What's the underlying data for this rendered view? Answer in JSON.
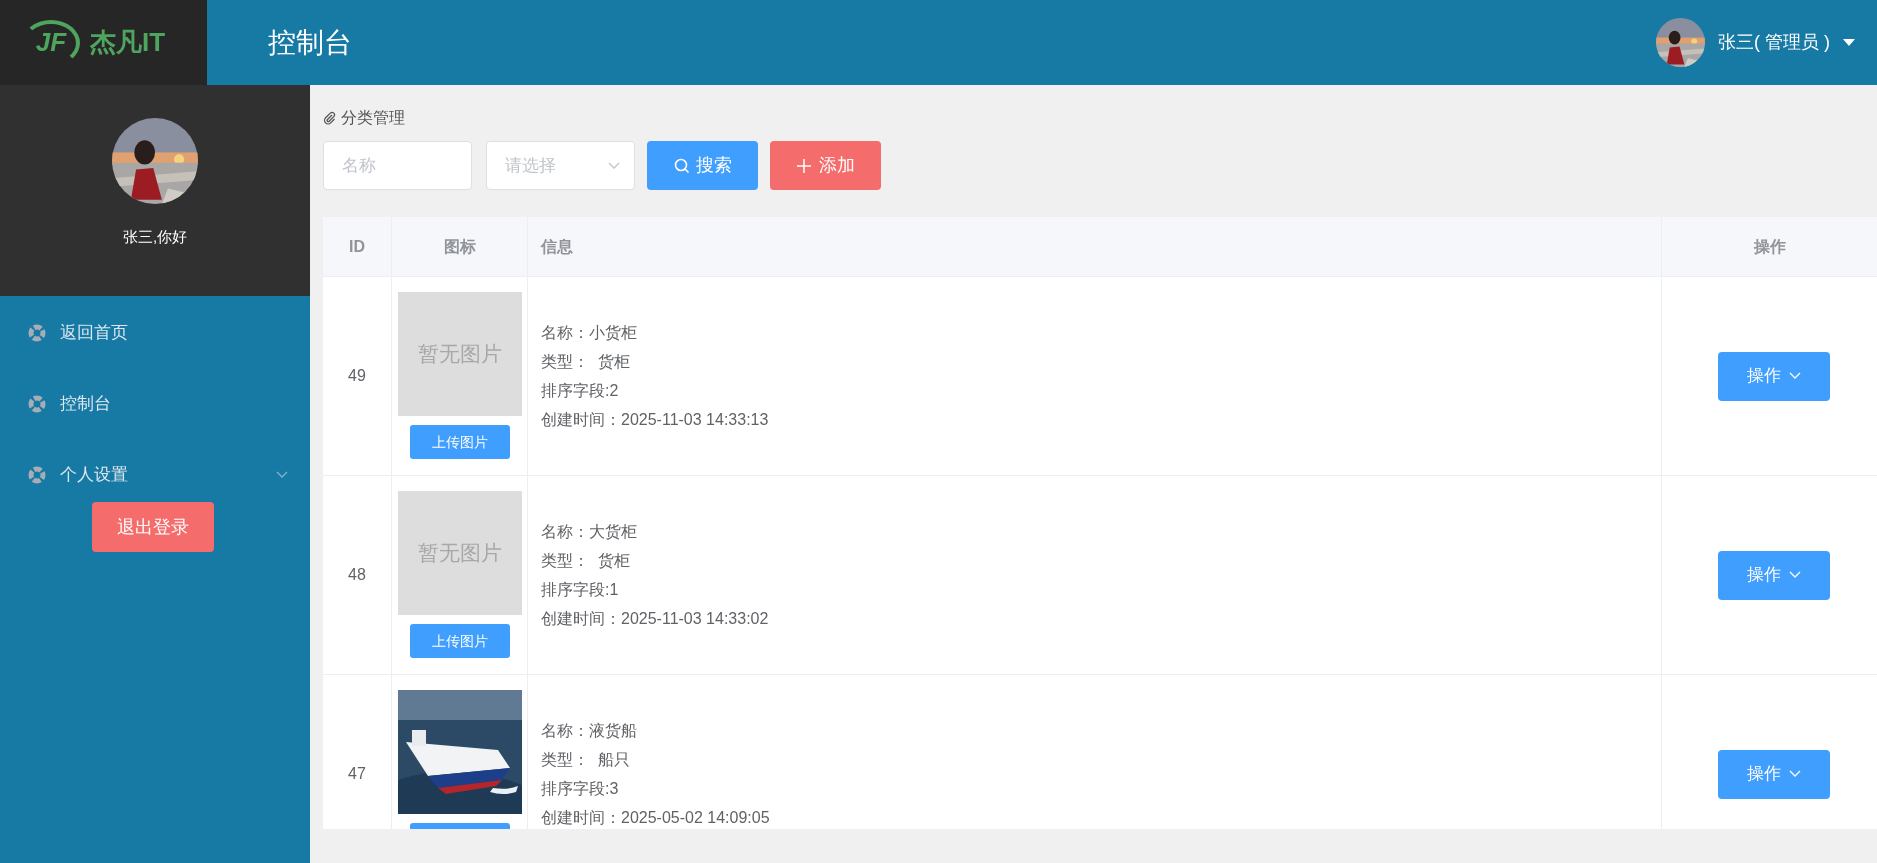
{
  "header": {
    "logo": {
      "mark": "JF",
      "name": "杰凡IT"
    },
    "title": "控制台",
    "user": {
      "name": "张三( 管理员 )"
    }
  },
  "sidebar": {
    "greeting": "张三,你好",
    "items": [
      {
        "label": "返回首页",
        "kind": "link"
      },
      {
        "label": "控制台",
        "kind": "link"
      },
      {
        "label": "个人设置",
        "kind": "submenu",
        "expanded": false
      }
    ],
    "logout": "退出登录"
  },
  "breadcrumb": "分类管理",
  "filters": {
    "name": {
      "placeholder": "名称"
    },
    "type": {
      "placeholder": "请选择"
    },
    "search": "搜索",
    "add": "添加"
  },
  "table": {
    "columns": [
      "ID",
      "图标",
      "信息",
      "操作"
    ],
    "rows": [
      {
        "id": "49",
        "image": {
          "kind": "placeholder",
          "text": "暂无图片"
        },
        "upload": "上传图片",
        "info": [
          "名称：小货柜",
          "类型：  货柜",
          "排序字段:2",
          "创建时间：2025-11-03 14:33:13"
        ],
        "action": "操作"
      },
      {
        "id": "48",
        "image": {
          "kind": "placeholder",
          "text": "暂无图片"
        },
        "upload": "上传图片",
        "info": [
          "名称：大货柜",
          "类型：  货柜",
          "排序字段:1",
          "创建时间：2025-11-03 14:33:02"
        ],
        "action": "操作"
      },
      {
        "id": "47",
        "info": [
          "名称：液货船",
          "类型：  船只",
          "排序字段:3",
          "创建时间：2025-05-02 14:09:05"
        ],
        "action": "操作"
      }
    ]
  }
}
